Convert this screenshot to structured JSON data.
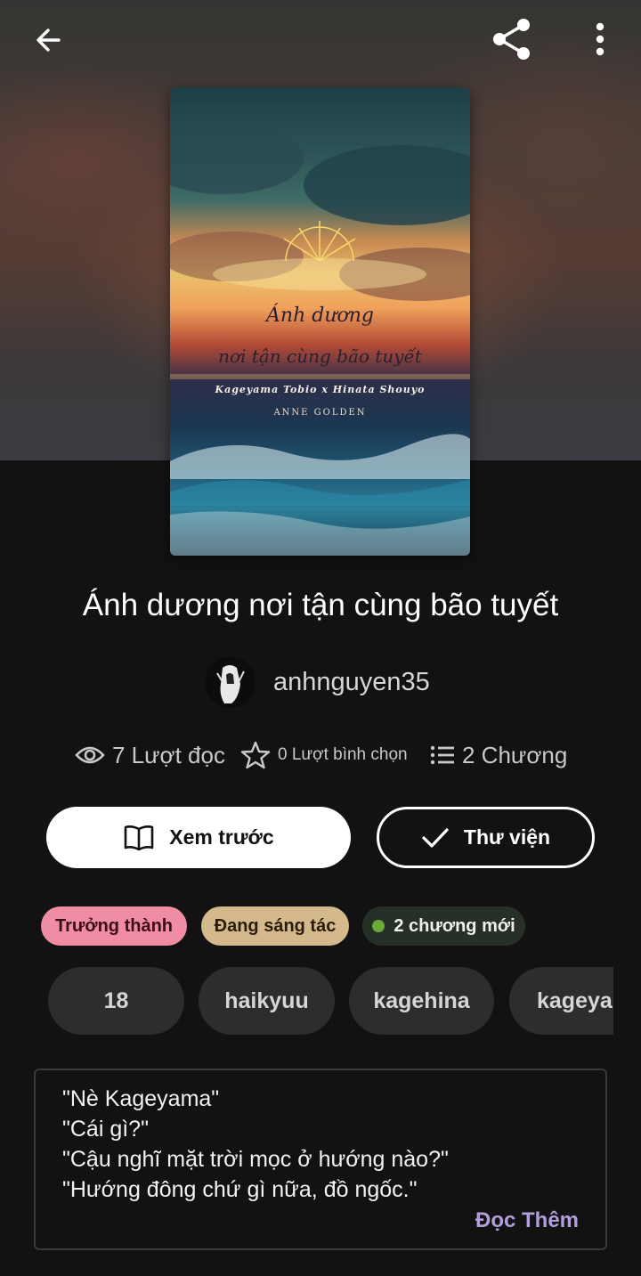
{
  "book": {
    "title": "Ánh dương nơi tận cùng bão tuyết",
    "author": "anhnguyen35",
    "cover": {
      "line1": "Ánh dương",
      "line2": "nơi tận cùng bão tuyết",
      "subtitle": "Kageyama Tobio x Hinata Shouyo",
      "author": "ANNE GOLDEN"
    }
  },
  "stats": {
    "reads": "7 Lượt đọc",
    "votes": "0 Lượt bình chọn",
    "chapters": "2 Chương"
  },
  "actions": {
    "preview": "Xem trước",
    "library": "Thư viện"
  },
  "badges": {
    "mature": "Trưởng thành",
    "ongoing": "Đang sáng tác",
    "new_chapters": "2 chương mới"
  },
  "tags": [
    "18",
    "haikyuu",
    "kagehina",
    "kageyama"
  ],
  "description": {
    "lines": [
      "\"Nè Kageyama\"",
      "\"Cái gì?\"",
      "\"Cậu nghĩ mặt trời mọc ở hướng nào?\"",
      "\"Hướng đông chứ gì nữa, đồ ngốc.\""
    ],
    "read_more": "Đọc Thêm"
  },
  "icons": {
    "back": "arrow-left-icon",
    "share": "share-icon",
    "more": "more-vertical-icon",
    "reads": "eye-icon",
    "votes": "star-icon",
    "chapters": "list-icon",
    "preview": "book-open-icon",
    "library": "check-icon"
  },
  "colors": {
    "background": "#121212",
    "mature_badge": "#f08ca3",
    "ongoing_badge": "#d4b98c",
    "new_badge": "#263026",
    "new_dot": "#6aaa3b",
    "read_more": "#b39ddb"
  }
}
